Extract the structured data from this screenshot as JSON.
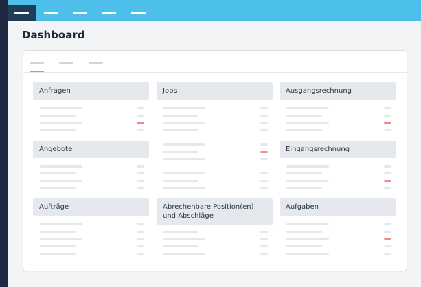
{
  "page": {
    "title": "Dashboard"
  },
  "colors": {
    "topbar": "#4cc0ea",
    "nav_active": "#1f3d57",
    "alert": "#f08a84",
    "background": "#1f2942"
  },
  "nav": {
    "items": [
      "item-1",
      "item-2",
      "item-3",
      "item-4",
      "item-5"
    ],
    "active_index": 0
  },
  "tabs": {
    "active_index": 0,
    "count": 3
  },
  "sections": [
    {
      "id": "anfragen",
      "label": "Anfragen"
    },
    {
      "id": "jobs",
      "label": "Jobs"
    },
    {
      "id": "ausgangsrechnung",
      "label": "Ausgangsrechnung"
    },
    {
      "id": "angebote",
      "label": "Angebote"
    },
    {
      "id": "eingangsrechnung",
      "label": "Eingangsrechnung"
    },
    {
      "id": "auftraege",
      "label": "Aufträge"
    },
    {
      "id": "abrechenbare",
      "label": "Abrechenbare Position(en) und Abschläge"
    },
    {
      "id": "aufgaben",
      "label": "Aufgaben"
    }
  ]
}
